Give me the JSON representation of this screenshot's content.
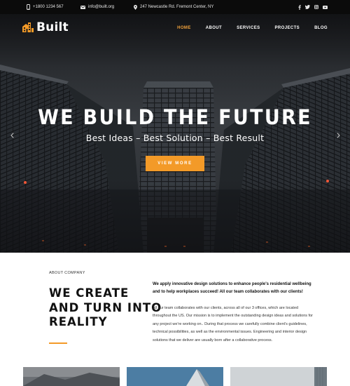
{
  "topbar": {
    "phone": "+1800 1234 567",
    "email": "info@built.org",
    "address": "247 Newcastle Rd. Fremont Center, NY",
    "social_icons": [
      "facebook-icon",
      "twitter-icon",
      "instagram-icon",
      "youtube-icon"
    ]
  },
  "brand": {
    "name": "Built",
    "accent_color": "#f39a28"
  },
  "nav": {
    "items": [
      "HOME",
      "ABOUT",
      "SERVICES",
      "PROJECTS",
      "BLOG"
    ],
    "active": "HOME"
  },
  "hero": {
    "title": "WE BUILD THE FUTURE",
    "subtitle": "Best Ideas – Best Solution – Best Result",
    "button_label": "VIEW MORE"
  },
  "about": {
    "tag": "ABOUT COMPANY",
    "title_lines": [
      "WE CREATE",
      "AND TURN INTO",
      "REALITY"
    ],
    "lead": "We apply innovative design solutions to enhance people's residential wellbeing and to help workplaces succeed! All our team collaborates with our clients!",
    "body": "All our team collaborates with our clients, across all of our 3 offices, which are located throughout the US. Our mission is to implement the outstanding design ideas and solutions for any project we're working on.. During that process we carefully combine client's guidelines, technical possibilities, as well as the environmental issues. Engineering and interior design solutions that we deliver are usually born after a collaborative process."
  }
}
